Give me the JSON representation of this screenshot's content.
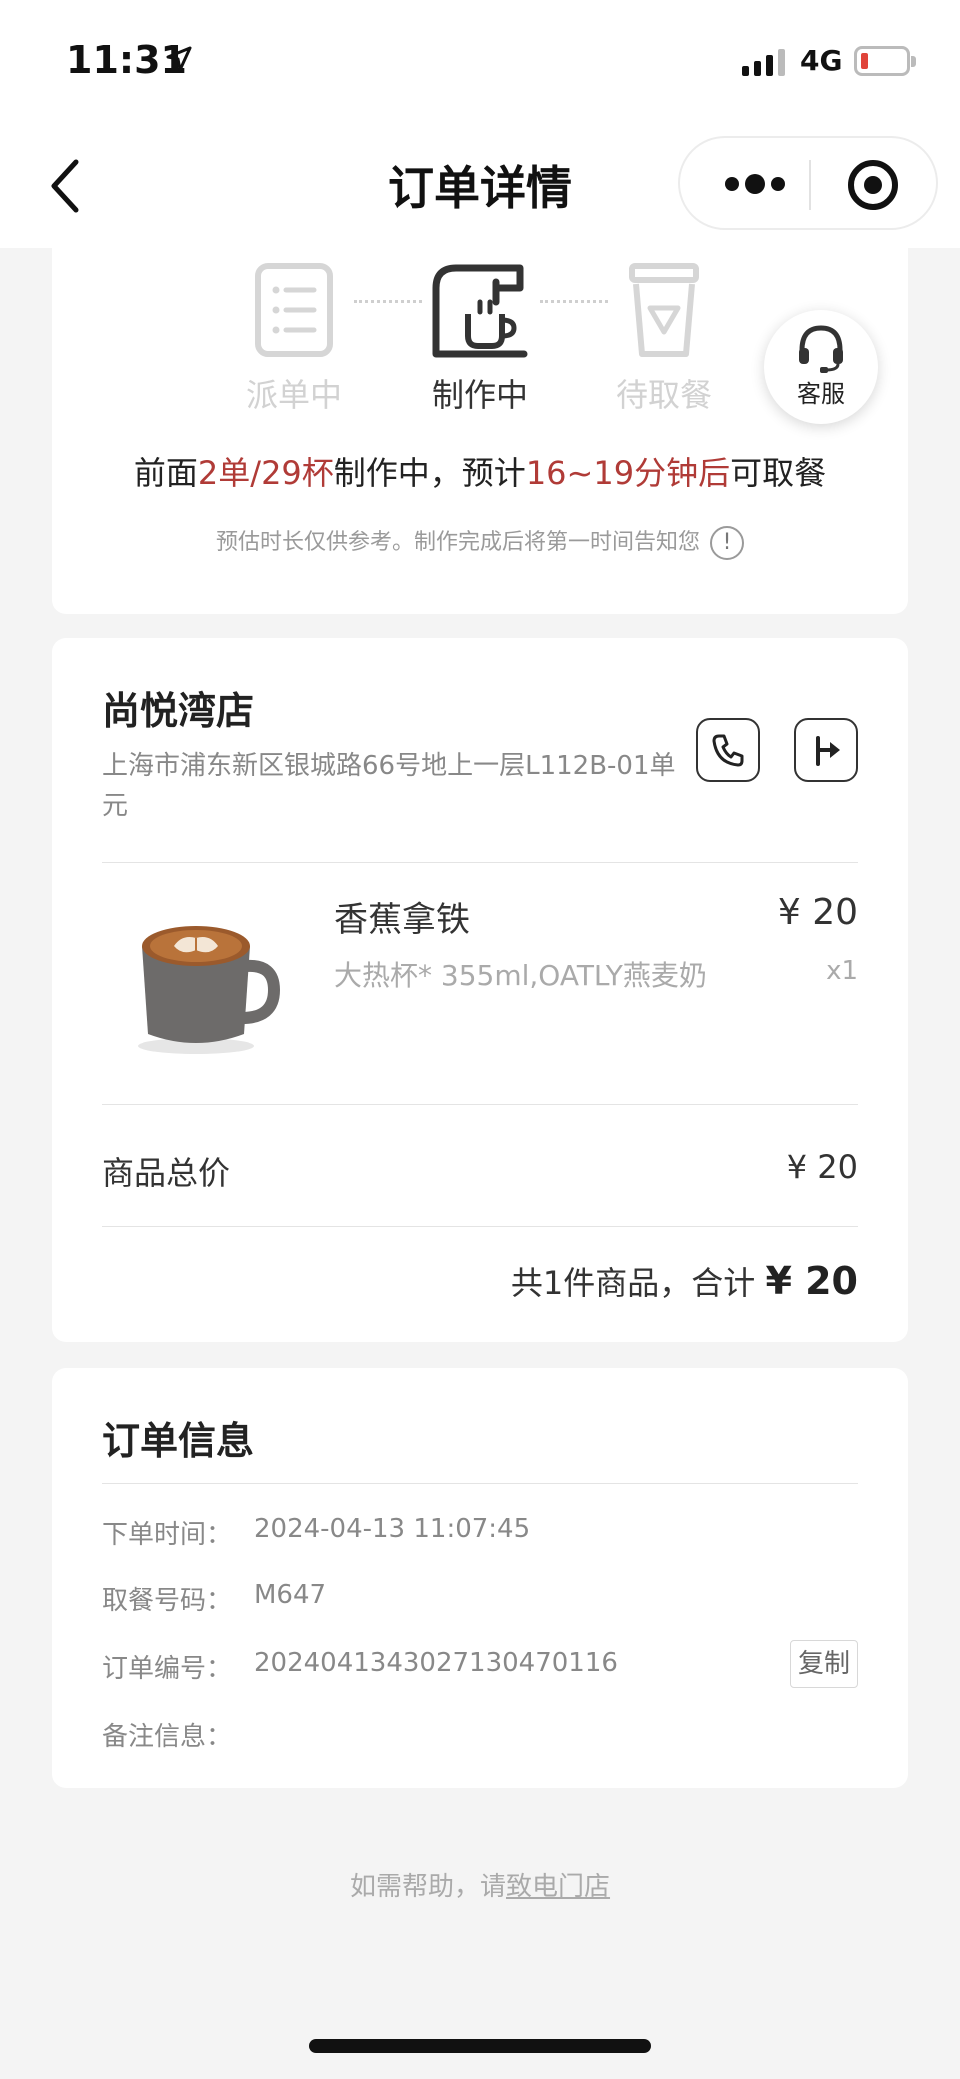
{
  "status_bar": {
    "time": "11:31",
    "network": "4G"
  },
  "nav": {
    "title": "订单详情"
  },
  "progress": {
    "steps": [
      {
        "label": "派单中"
      },
      {
        "label": "制作中"
      },
      {
        "label": "待取餐"
      }
    ],
    "service_label": "客服",
    "eta": {
      "prefix": "前面",
      "queue": "2单/29杯",
      "middle": "制作中，预计",
      "time": "16~19分钟后",
      "suffix": "可取餐"
    },
    "note": "预估时长仅供参考。制作完成后将第一时间告知您",
    "note_icon": "!"
  },
  "store": {
    "name": "尚悦湾店",
    "address": "上海市浦东新区银城路66号地上一层L112B-01单元"
  },
  "product": {
    "name": "香蕉拿铁",
    "spec": "大热杯* 355ml,OATLY燕麦奶",
    "price": "¥ 20",
    "qty": "x1"
  },
  "summary": {
    "subtotal_label": "商品总价",
    "subtotal_value": "¥ 20",
    "total_text": "共1件商品，合计 ",
    "total_amount": "¥ 20"
  },
  "order_info": {
    "title": "订单信息",
    "order_time_label": "下单时间：",
    "order_time": "2024-04-13 11:07:45",
    "pickup_label": "取餐号码：",
    "pickup_code": "M647",
    "order_no_label": "订单编号：",
    "order_no": "20240413430271304701​16",
    "copy_label": "复制",
    "remark_label": "备注信息："
  },
  "help": {
    "prefix": "如需帮助，请",
    "link": "致电门店"
  },
  "colors": {
    "accent": "#b03b37",
    "inactive": "#d2d2d2"
  },
  "icons": [
    "location-arrow-icon",
    "signal-icon",
    "battery-icon",
    "back-chevron-icon",
    "more-dots-icon",
    "target-icon",
    "order-list-icon",
    "coffee-machine-icon",
    "pickup-cup-icon",
    "headset-icon",
    "info-icon",
    "phone-icon",
    "navigation-icon"
  ]
}
